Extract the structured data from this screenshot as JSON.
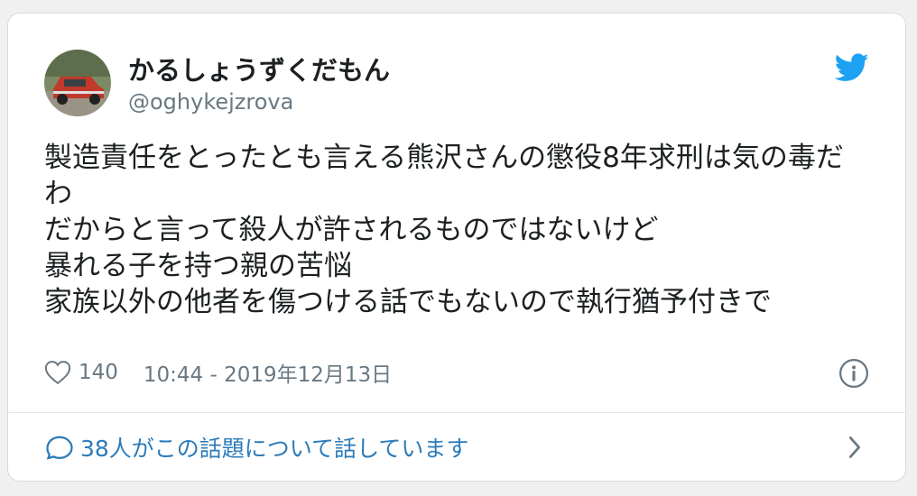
{
  "user": {
    "display_name": "かるしょうずくだもん",
    "handle": "@oghykejzrova"
  },
  "tweet": {
    "lines": [
      "製造責任をとったとも言える熊沢さんの懲役8年求刑は気の毒だ",
      "わ",
      "だからと言って殺人が許されるものではないけど",
      "暴れる子を持つ親の苦悩",
      "家族以外の他者を傷つける話でもないので執行猶予付きで"
    ]
  },
  "meta": {
    "likes": "140",
    "timestamp": "10:44 - 2019年12月13日"
  },
  "conversation": {
    "label": "38人がこの話題について話しています"
  },
  "icons": {
    "logo": "twitter-bird-icon",
    "like": "heart-icon",
    "info": "info-icon",
    "conversation": "speech-bubble-icon",
    "more": "chevron-right-icon"
  },
  "colors": {
    "brand": "#1da1f2",
    "link": "#2b7bb9",
    "text": "#1c2022",
    "secondary": "#697882"
  }
}
